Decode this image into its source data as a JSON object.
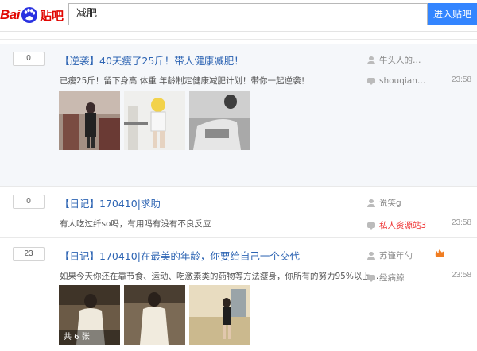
{
  "header": {
    "logo_text_left": "Bai",
    "logo_text_right": "贴吧",
    "search_value": "减肥",
    "search_button": "进入贴吧"
  },
  "threads": [
    {
      "replies": "0",
      "title": "【逆袭】40天瘦了25斤！带人健康减肥！",
      "excerpt": "已瘦25斤！留下身高 体重 年龄制定健康减肥计划！带你一起逆袭！",
      "author": "牛头人的…",
      "last_reply_user": "shouqian…",
      "time": "23:58"
    },
    {
      "replies": "0",
      "title": "【日记】170410|求助",
      "excerpt": "有人吃过纤so吗，有用吗有没有不良反应",
      "author": "说笑g",
      "last_reply_user": "私人资源站3",
      "time": "23:58"
    },
    {
      "replies": "23",
      "title": "【日记】170410|在最美的年龄，你要给自己一个交代",
      "excerpt": "如果今天你还在靠节食、运动、吃激素类的药物等方法瘦身，你所有的努力95%以上…",
      "author": "苏谨年勺",
      "last_reply_user": "经病鯨",
      "time": "23:58",
      "photo_count": "共 6 张"
    }
  ],
  "colors": {
    "brand_red": "#e10601",
    "link_blue": "#2d64b3",
    "button_blue": "#3385ff"
  }
}
